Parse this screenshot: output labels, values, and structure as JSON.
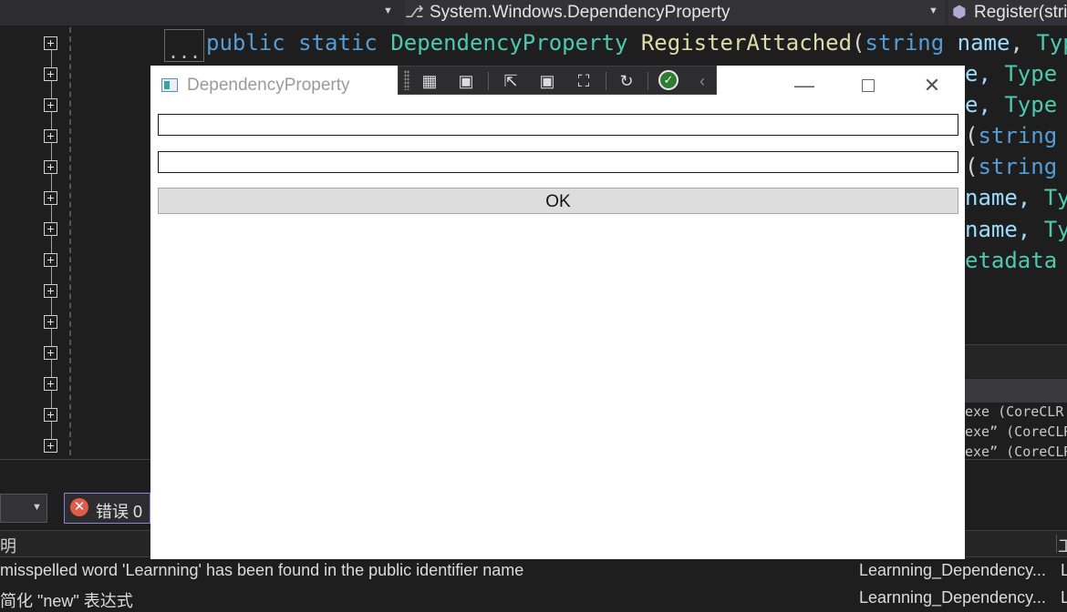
{
  "navbar": {
    "member_dropdown": {
      "icon": "class-hierarchy-icon",
      "label": "System.Windows.DependencyProperty"
    },
    "method_dropdown": {
      "icon": "method-cube-icon",
      "label": "Register(stri"
    }
  },
  "editor": {
    "collapsed_marker": "...",
    "line1": {
      "kw_public": "public",
      "kw_static": "static",
      "type": "DependencyProperty",
      "method": "RegisterAttached",
      "open": "(",
      "kw_string": "string",
      "param": "name",
      "comma": ",",
      "type2": "Type"
    },
    "fragments": [
      {
        "text": "e,",
        "text2": "Type"
      },
      {
        "text": "e,",
        "text2": "Type"
      },
      {
        "text": "(",
        "text2": "string"
      },
      {
        "text": "(",
        "text2": "string"
      },
      {
        "text": "name,",
        "text2": "Ty"
      },
      {
        "text": "name,",
        "text2": "Ty"
      },
      {
        "text": "etadata",
        "text2": ""
      }
    ],
    "output_lines": [
      "exe  (CoreCLR",
      "exe” (CoreCLR",
      "exe” (CoreCLR"
    ]
  },
  "wpf_window": {
    "title": "DependencyProperty",
    "textbox1_value": "",
    "textbox2_value": "",
    "ok_label": "OK",
    "minimize": "—",
    "close": "✕"
  },
  "debug_toolbar": {
    "icons": [
      "select-element-icon",
      "record-icon",
      "select-in-app-icon",
      "layout-adorners-icon",
      "track-focus-icon",
      "hot-reload-icon",
      "check-icon",
      "collapse-icon"
    ]
  },
  "error_list": {
    "errors_label": "错误 0",
    "column_description": "明",
    "column_project": "工",
    "rows": [
      {
        "description": "misspelled word 'Learnning' has been found in the public identifier name",
        "project": "Learnning_Dependency...",
        "extra": "L"
      },
      {
        "description": "简化 \"new\" 表达式",
        "project": "Learnning_Dependency...",
        "extra": "L"
      }
    ]
  }
}
